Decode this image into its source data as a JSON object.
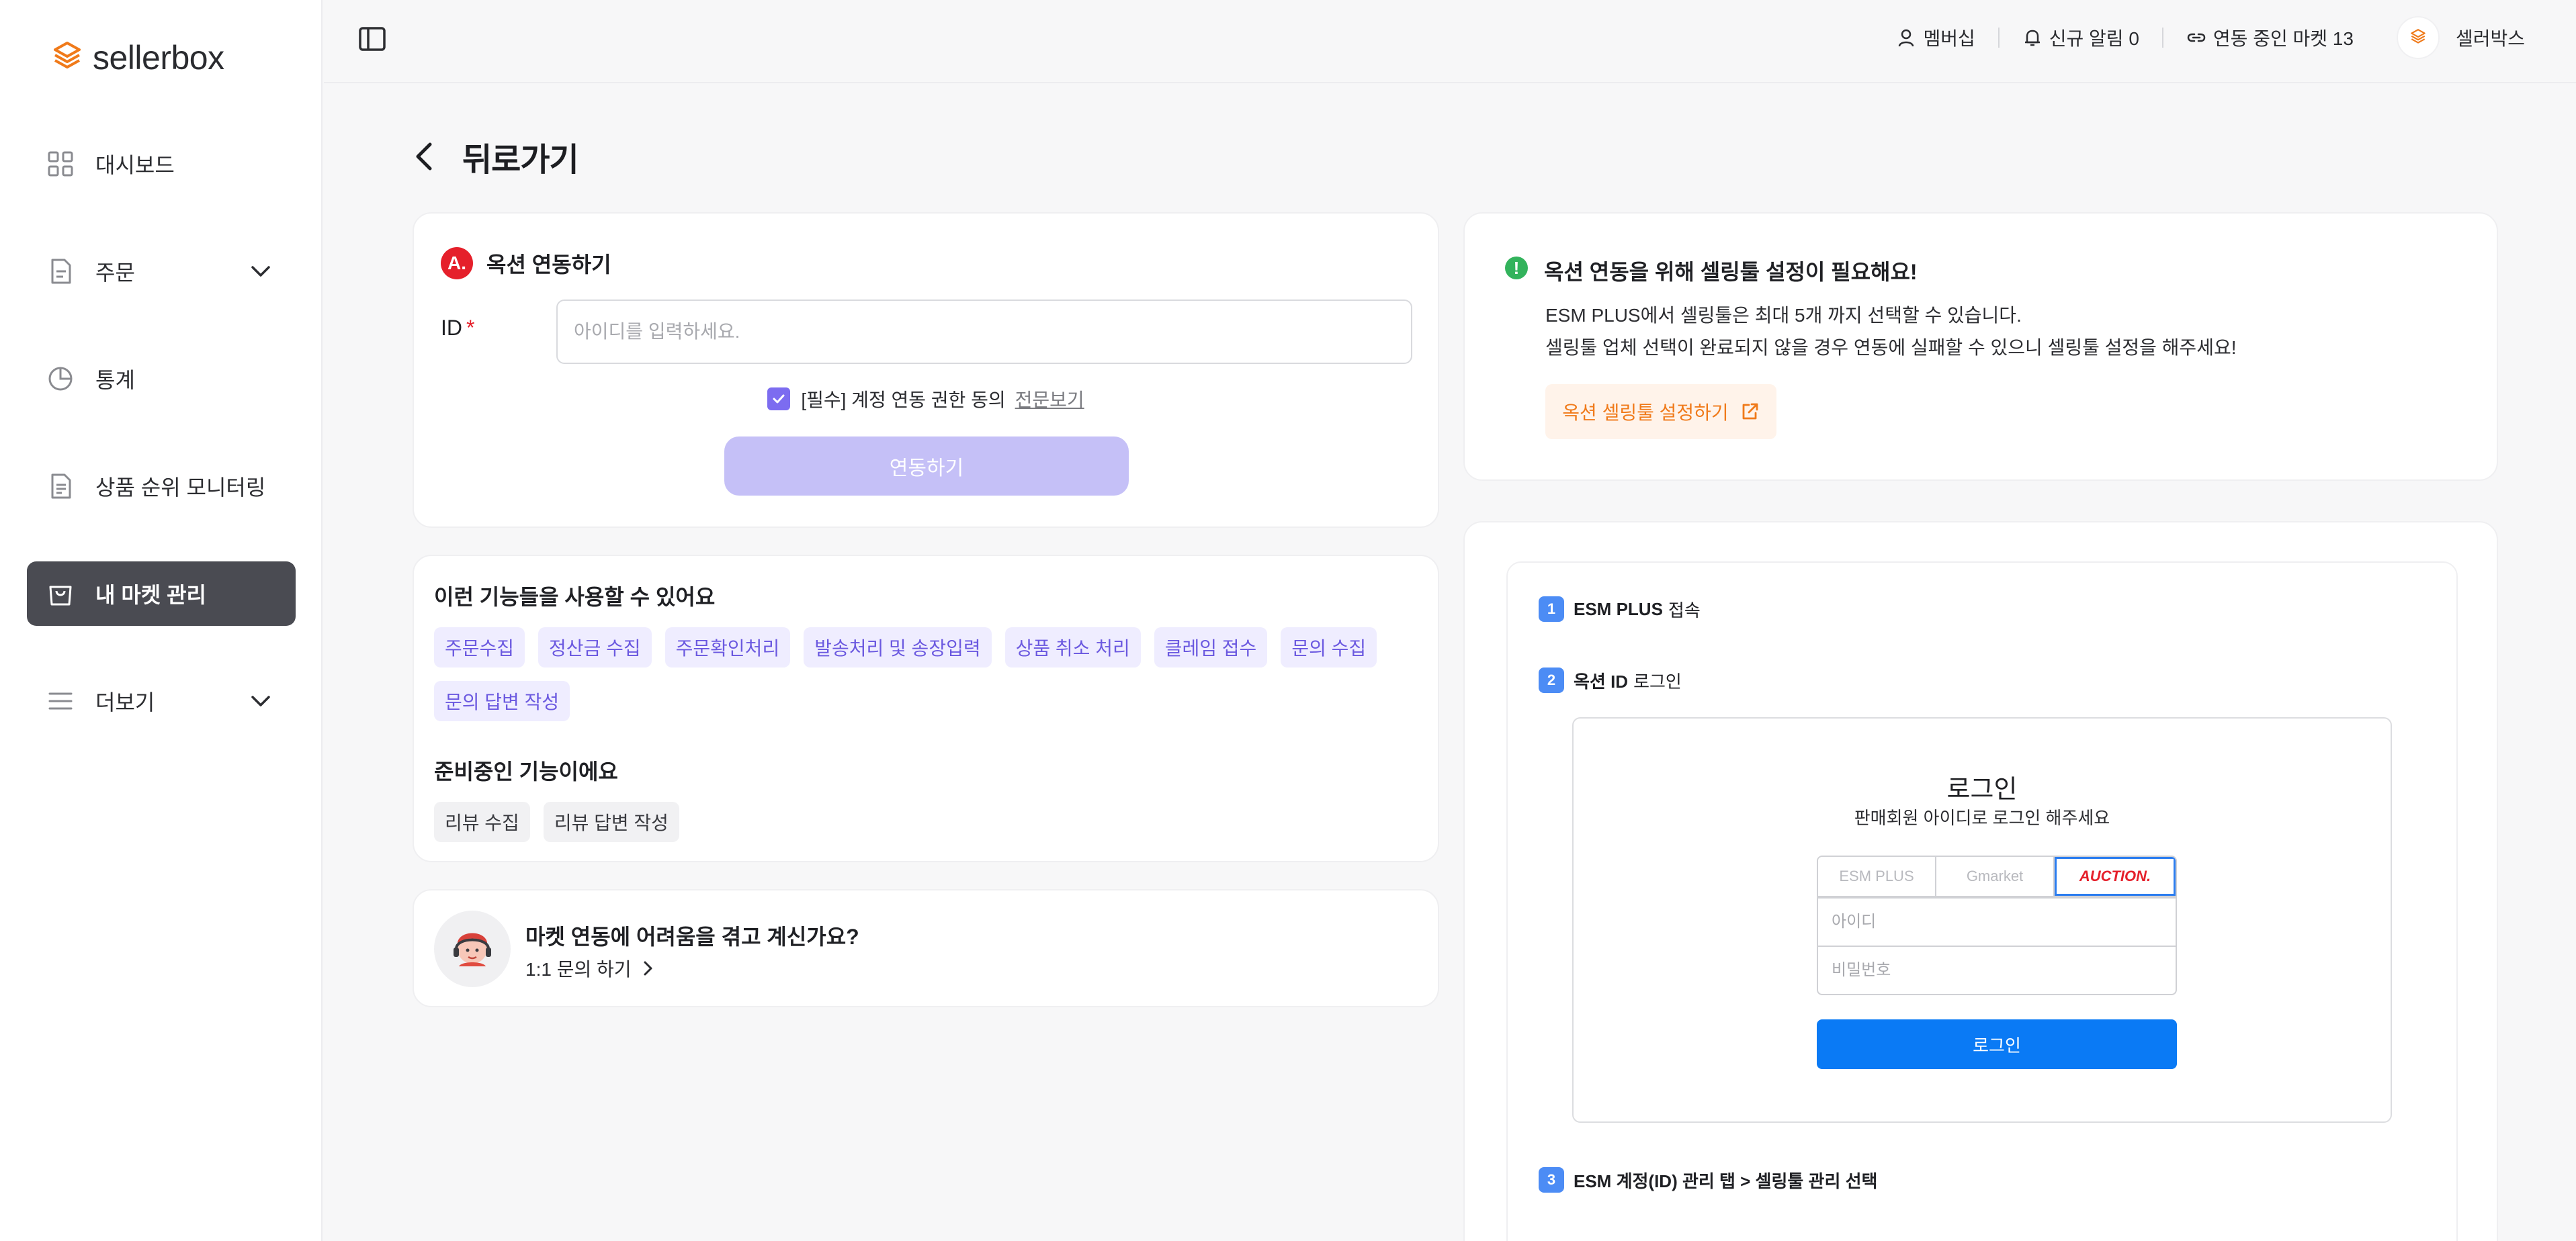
{
  "brand": {
    "name": "sellerbox",
    "accent": "#f07a1a"
  },
  "sidebar": {
    "items": [
      {
        "label": "대시보드",
        "icon": "grid-icon",
        "expandable": false,
        "active": false
      },
      {
        "label": "주문",
        "icon": "document-icon",
        "expandable": true,
        "active": false
      },
      {
        "label": "통계",
        "icon": "pie-chart-icon",
        "expandable": false,
        "active": false
      },
      {
        "label": "상품 순위 모니터링",
        "icon": "file-list-icon",
        "expandable": false,
        "active": false
      },
      {
        "label": "내 마켓 관리",
        "icon": "shopping-bag-icon",
        "expandable": false,
        "active": true
      },
      {
        "label": "더보기",
        "icon": "menu-icon",
        "expandable": true,
        "active": false
      }
    ]
  },
  "header": {
    "membership": "멤버십",
    "notifications": "신규 알림 0",
    "linked_markets": "연동 중인 마켓 13",
    "user_name": "셀러박스",
    "avatar_text": "sellerbox"
  },
  "page": {
    "back_label": "뒤로가기"
  },
  "connect": {
    "title": "옥션 연동하기",
    "badge": "A.",
    "id_label": "ID",
    "required_mark": "*",
    "id_placeholder": "아이디를 입력하세요.",
    "id_value": "",
    "agree_text": "[필수] 계정 연동 권한 동의",
    "agree_link": "전문보기",
    "agree_checked": true,
    "button": "연동하기"
  },
  "features": {
    "available_title": "이런 기능들을 사용할 수 있어요",
    "available": [
      "주문수집",
      "정산금 수집",
      "주문확인처리",
      "발송처리 및 송장입력",
      "상품 취소 처리",
      "클레임 접수",
      "문의 수집",
      "문의 답변 작성"
    ],
    "upcoming_title": "준비중인 기능이에요",
    "upcoming": [
      "리뷰 수집",
      "리뷰 답변 작성"
    ]
  },
  "help": {
    "title": "마켓 연동에 어려움을 겪고 계신가요?",
    "link": "1:1 문의 하기"
  },
  "notice": {
    "icon": "!",
    "title": "옥션 연동을 위해 셀링툴 설정이 필요해요!",
    "line1": "ESM PLUS에서 셀링툴은 최대 5개 까지 선택할 수 있습니다.",
    "line2": "셀링툴 업체 선택이 완료되지 않을 경우 연동에 실패할 수 있으니 셀링툴 설정을 해주세요!",
    "button": "옥션 셀링툴 설정하기"
  },
  "steps": [
    {
      "num": "1",
      "bold": "ESM PLUS",
      "rest": "접속"
    },
    {
      "num": "2",
      "bold": "옥션 ID",
      "rest": "로그인"
    },
    {
      "num": "3",
      "bold": "ESM 계정(ID) 관리 탭 > 셀링툴 관리 선택",
      "rest": ""
    }
  ],
  "login_preview": {
    "title": "로그인",
    "subtitle": "판매회원 아이디로 로그인 해주세요",
    "tabs": [
      "ESM PLUS",
      "Gmarket",
      "AUCTION."
    ],
    "selected_tab": 2,
    "id_placeholder": "아이디",
    "pw_placeholder": "비밀번호",
    "button": "로그인"
  }
}
